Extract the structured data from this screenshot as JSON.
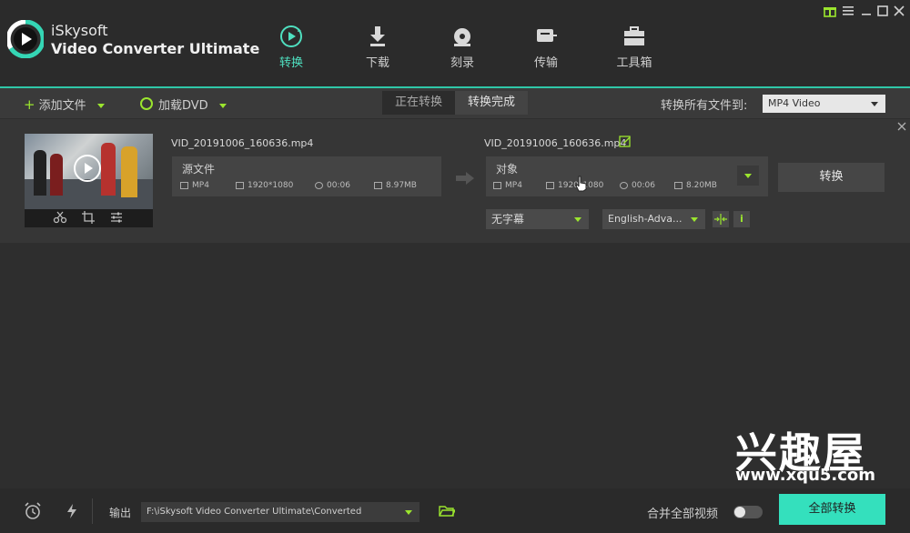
{
  "app": {
    "name_line1": "iSkysoft",
    "name_line2": "Video Converter Ultimate"
  },
  "nav": [
    {
      "label": "转换",
      "icon": "convert-icon",
      "active": true
    },
    {
      "label": "下载",
      "icon": "download-icon",
      "active": false
    },
    {
      "label": "刻录",
      "icon": "burn-icon",
      "active": false
    },
    {
      "label": "传输",
      "icon": "transfer-icon",
      "active": false
    },
    {
      "label": "工具箱",
      "icon": "toolbox-icon",
      "active": false
    }
  ],
  "window_controls": [
    "gift-icon",
    "menu-icon",
    "minimize-icon",
    "maximize-icon",
    "close-icon"
  ],
  "toolbar": {
    "add_files": "添加文件",
    "load_dvd": "加载DVD",
    "tab_converting": "正在转换",
    "tab_finished": "转换完成",
    "convert_all_to_label": "转换所有文件到:",
    "convert_all_to_value": "MP4 Video"
  },
  "file": {
    "source_name": "VID_20191006_160636.mp4",
    "source_label": "源文件",
    "source_format": "MP4",
    "source_resolution": "1920*1080",
    "source_duration": "00:06",
    "source_size": "8.97MB",
    "target_name": "VID_20191006_160636.mp4",
    "target_label": "对象",
    "target_format": "MP4",
    "target_resolution": "1920*1080",
    "target_duration": "00:06",
    "target_size": "8.20MB",
    "convert_button": "转换",
    "subtitle_value": "无字幕",
    "audio_value": "English-Adva..."
  },
  "bottom": {
    "output_label": "输出",
    "output_path": "F:\\iSkysoft Video Converter Ultimate\\Converted",
    "merge_label": "合并全部视频",
    "convert_all_button": "全部转换"
  },
  "watermark": {
    "line1": "兴趣屋",
    "line2": "www.xqu5.com"
  },
  "colors": {
    "accent": "#2fc7a8",
    "green_icon": "#9be52e",
    "convert_all_bg": "#34e0bd"
  }
}
